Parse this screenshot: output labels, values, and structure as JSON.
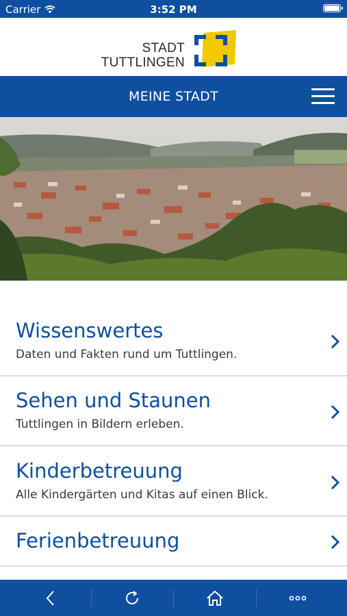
{
  "status_bar": {
    "carrier": "Carrier",
    "time": "3:52 PM"
  },
  "logo": {
    "line1": "STADT",
    "line2": "TUTTLINGEN"
  },
  "nav": {
    "title": "MEINE STADT",
    "menu_icon": "hamburger-menu-icon"
  },
  "hero": {
    "image": "aerial-photo-of-tuttlingen"
  },
  "list": [
    {
      "title": "Wissenswertes",
      "subtitle": "Daten und Fakten rund um Tuttlingen."
    },
    {
      "title": "Sehen und Staunen",
      "subtitle": "Tuttlingen in Bildern erleben."
    },
    {
      "title": "Kinderbetreuung",
      "subtitle": "Alle Kindergärten und Kitas auf einen Blick."
    },
    {
      "title": "Ferienbetreuung",
      "subtitle": ""
    }
  ],
  "toolbar": {
    "icons": [
      "back-icon",
      "reload-icon",
      "home-icon",
      "more-icon"
    ]
  },
  "colors": {
    "brand_blue": "#0e4fa0",
    "logo_yellow": "#f2c800",
    "divider": "#dcdcdc"
  }
}
